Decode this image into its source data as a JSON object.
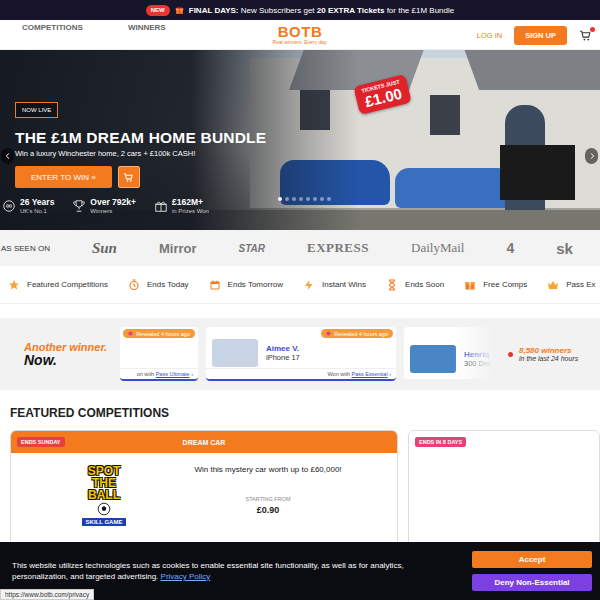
{
  "promo_bar": {
    "badge": "NEW",
    "segments": [
      {
        "text": "FINAL DAYS:",
        "bold": true
      },
      {
        "text": " New Subscribers get ",
        "bold": false
      },
      {
        "text": "20 EXTRA Tickets",
        "bold": true
      },
      {
        "text": " for the £1M Bundle",
        "bold": false
      }
    ]
  },
  "header": {
    "nav": [
      "COMPETITIONS",
      "WINNERS"
    ],
    "logo": "BOTB",
    "tagline": "Real winners. Every day.",
    "login": "LOG IN",
    "signup": "SIGN UP",
    "cart_has_items": true
  },
  "hero": {
    "tag": "NOW LIVE",
    "title": "THE £1M DREAM HOME BUNDLE",
    "subtitle": "Win a luxury Winchester home, 2 cars + £100k CASH!",
    "cta": "ENTER TO WIN »",
    "sticker": {
      "line1": "TICKETS JUST",
      "price": "£1.00"
    },
    "dots": [
      {
        "selected": true
      },
      {
        "selected": false
      },
      {
        "selected": false
      },
      {
        "selected": false
      },
      {
        "selected": false
      },
      {
        "selected": false
      },
      {
        "selected": false
      },
      {
        "selected": false
      }
    ],
    "stats": [
      {
        "value": "26 Years",
        "label": "UK's No.1"
      },
      {
        "value": "Over 792k+",
        "label": "Winners"
      },
      {
        "value": "£162M+",
        "label": "in Prizes Won"
      }
    ]
  },
  "seen_on": {
    "label": "AS SEEN ON",
    "logos": [
      "Sun",
      "Mirror",
      "STAR",
      "EXPRESS",
      "DailyMail",
      "4",
      "sk"
    ]
  },
  "categories": [
    {
      "label": "Featured Competitions"
    },
    {
      "label": "Ends Today"
    },
    {
      "label": "Ends Tomorrow"
    },
    {
      "label": "Instant Wins"
    },
    {
      "label": "Ends Soon"
    },
    {
      "label": "Free Comps"
    },
    {
      "label": "Pass Ex"
    }
  ],
  "winners": {
    "headline1": "Another winner.",
    "headline2": "Now.",
    "cards": [
      {
        "kind": "partial",
        "badge": "Revealed 4 hours ago",
        "won_prefix": "on with",
        "pass": "Pass Ultimate",
        "arrow": "›"
      },
      {
        "kind": "full",
        "name": "Aimee V.",
        "prize": "iPhone 17",
        "badge": "Revealed 4 hours ago",
        "won_prefix": "Won with",
        "pass": "Pass Essential",
        "arrow": "›"
      },
      {
        "kind": "faded",
        "name": "Henriq",
        "prize": "300 Dre"
      }
    ],
    "count": "8,580 winners",
    "count_label": "in the last 24 hours"
  },
  "featured": {
    "heading": "FEATURED COMPETITIONS",
    "cards": [
      {
        "kind": "orange",
        "ends": "ENDS SUNDAY",
        "ends_color": "#e8413c",
        "title": "DREAM CAR",
        "logo": [
          "SPOT",
          "THE",
          "BALL"
        ],
        "logo_banner": "SKILL GAME",
        "description": "Win this mystery car worth up to £60,000!",
        "price_label": "STARTING FROM",
        "price": "£0.90"
      },
      {
        "kind": "plain",
        "ends": "ENDS IN 8 DAYS",
        "ends_color": "#e8417a"
      }
    ]
  },
  "cookie": {
    "text": "This website utilizes technologies such as cookies to enable essential site functionality, as well as for analytics, personalization, and targeted advertising.",
    "link": "Privacy Policy",
    "accept": "Accept",
    "deny": "Deny Non-Essential"
  },
  "status_bar": {
    "url": "https://www.botb.com/privacy"
  }
}
